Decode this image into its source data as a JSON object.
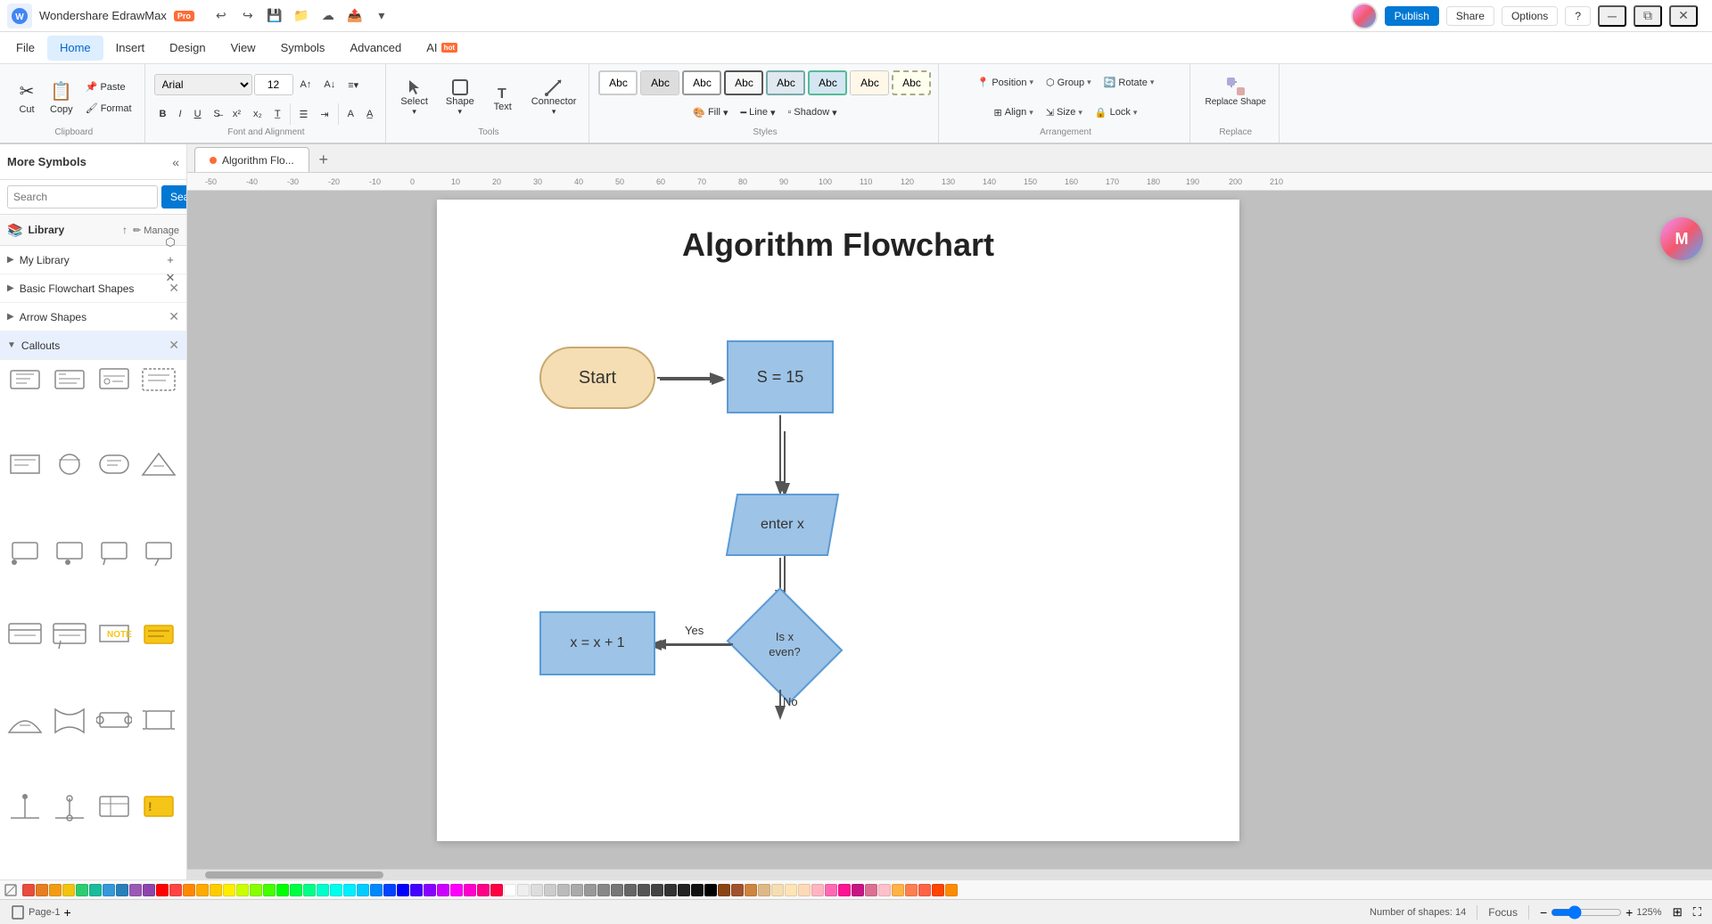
{
  "app": {
    "name": "Wondershare EdrawMax",
    "badge": "Pro",
    "title_bar": {
      "undo": "↩",
      "redo": "↪",
      "save": "💾",
      "open": "📁",
      "cloud": "☁",
      "export": "📤",
      "more": "▾",
      "minimize": "─",
      "restore": "⧉",
      "close": "✕"
    }
  },
  "menu": {
    "items": [
      "File",
      "Home",
      "Insert",
      "Design",
      "View",
      "Symbols",
      "Advanced",
      "AI 🔥"
    ]
  },
  "ribbon": {
    "clipboard_label": "Clipboard",
    "font_label": "Font and Alignment",
    "tools_label": "Tools",
    "styles_label": "Styles",
    "arrangement_label": "Arrangement",
    "replace_label": "Replace",
    "font_name": "Arial",
    "font_size": "12",
    "select_label": "Select",
    "shape_label": "Shape",
    "text_label": "Text",
    "connector_label": "Connector",
    "fill_label": "Fill",
    "line_label": "Line",
    "shadow_label": "Shadow",
    "position_label": "Position",
    "group_label": "Group",
    "rotate_label": "Rotate",
    "align_label": "Align",
    "size_label": "Size",
    "lock_label": "Lock",
    "replace_shape_label": "Replace Shape"
  },
  "topbar": {
    "publish": "Publish",
    "share": "Share",
    "options": "Options",
    "help": "?"
  },
  "panel": {
    "title": "More Symbols",
    "search_placeholder": "Search",
    "search_btn": "Search",
    "library_label": "Library",
    "my_library_label": "My Library",
    "basic_flowchart_label": "Basic Flowchart Shapes",
    "arrow_shapes_label": "Arrow Shapes",
    "callouts_label": "Callouts"
  },
  "tab": {
    "name": "Algorithm Flo...",
    "dot": true
  },
  "page": {
    "name": "Page-1"
  },
  "canvas": {
    "title": "Algorithm Flowchart",
    "shapes": {
      "start": "Start",
      "s15": "S = 15",
      "enter_x": "enter x",
      "condition": "Is x\neven?",
      "yes_label": "Yes",
      "no_label": "No",
      "x_plus": "x = x + 1"
    }
  },
  "status": {
    "shapes_count": "Number of shapes: 14",
    "focus": "Focus",
    "zoom": "125%",
    "page": "Page-1"
  },
  "colors": [
    "#e74c3c",
    "#e67e22",
    "#f39c12",
    "#f1c40f",
    "#2ecc71",
    "#1abc9c",
    "#3498db",
    "#2980b9",
    "#9b59b6",
    "#8e44ad",
    "#ff0000",
    "#ff4444",
    "#ff8800",
    "#ffaa00",
    "#ffcc00",
    "#ffee00",
    "#ccff00",
    "#88ff00",
    "#44ff00",
    "#00ff00",
    "#00ff44",
    "#00ff88",
    "#00ffcc",
    "#00ffee",
    "#00eeff",
    "#00ccff",
    "#0088ff",
    "#0044ff",
    "#0000ff",
    "#4400ff",
    "#8800ff",
    "#cc00ff",
    "#ff00ff",
    "#ff00cc",
    "#ff0088",
    "#ff0044",
    "#ffffff",
    "#eeeeee",
    "#dddddd",
    "#cccccc",
    "#bbbbbb",
    "#aaaaaa",
    "#999999",
    "#888888",
    "#777777",
    "#666666",
    "#555555",
    "#444444",
    "#333333",
    "#222222",
    "#111111",
    "#000000",
    "#8B4513",
    "#A0522D",
    "#CD853F",
    "#DEB887",
    "#F5DEB3",
    "#FFE4B5",
    "#FFDAB9",
    "#FFB6C1",
    "#FF69B4",
    "#FF1493",
    "#C71585",
    "#DB7093",
    "#FFC0CB",
    "#FFB347",
    "#FF7F50",
    "#FF6347",
    "#FF4500",
    "#FF8C00"
  ]
}
